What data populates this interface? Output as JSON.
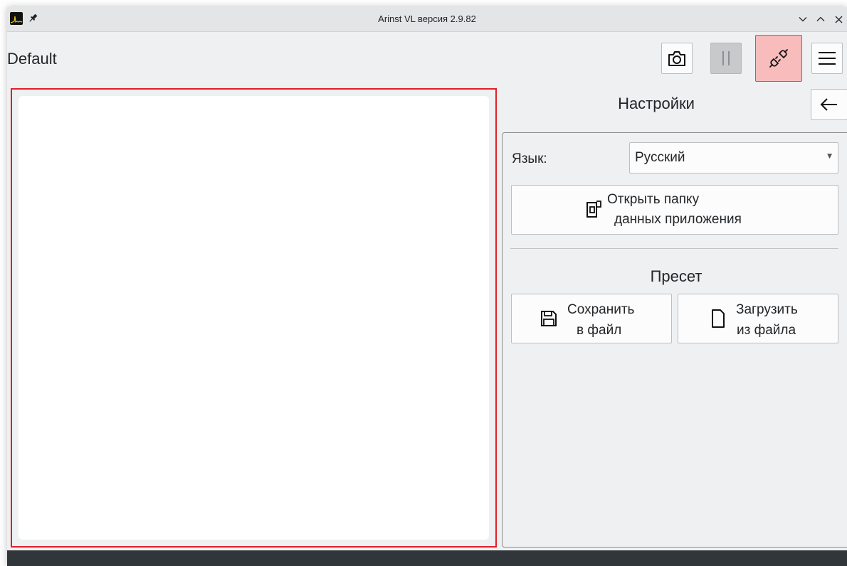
{
  "window": {
    "title": "Arinst VL версия 2.9.82"
  },
  "toolbar": {
    "preset_name": "Default",
    "camera_icon": "camera-icon",
    "pause_icon": "pause-icon",
    "connect_icon": "plug-connect-icon",
    "menu_icon": "hamburger-menu-icon",
    "connect_highlight_color": "#f8bcbc",
    "connect_border_color": "#e04a4a"
  },
  "chart": {
    "frame_color": "#e21f26"
  },
  "settings": {
    "title": "Настройки",
    "back_icon": "arrow-left-icon",
    "language_label": "Язык:",
    "language_value": "Русский",
    "open_folder_line1": "Открыть папку",
    "open_folder_line2": "данных приложения",
    "open_folder_icon": "document-folder-icon",
    "preset_section_title": "Пресет",
    "save_line1": "Сохранить",
    "save_line2": "в файл",
    "save_icon": "floppy-disk-icon",
    "load_line1": "Загрузить",
    "load_line2": "из файла",
    "load_icon": "document-icon"
  }
}
